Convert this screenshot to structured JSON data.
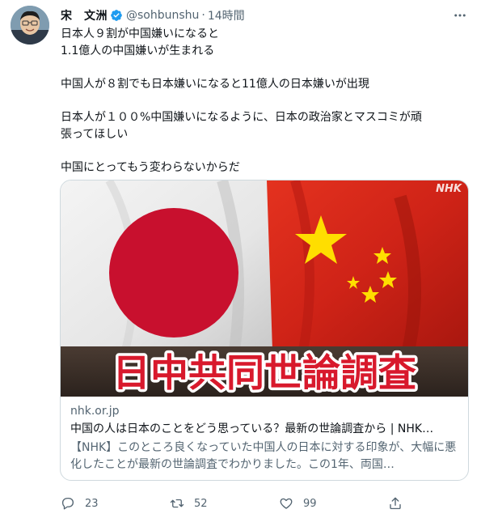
{
  "author": {
    "name": "宋　文洲",
    "handle": "@sohbunshu",
    "separator": "·",
    "time": "14時間"
  },
  "tweet": {
    "lines": [
      "日本人９割が中国嫌いになると",
      "1.1億人の中国嫌いが生まれる",
      "中国人が８割でも日本嫌いになると11億人の日本嫌いが出現",
      "日本人が１００%中国嫌いになるように、日本の政治家とマスコミが頑",
      "張ってほしい",
      "中国にとってもう変わらないからだ"
    ]
  },
  "card": {
    "image_banner": "日中共同世論調査",
    "image_watermark": "NHK",
    "domain": "nhk.or.jp",
    "title": "中国の人は日本のことをどう思っている？最新の世論調査から | NHK…",
    "description": "【NHK】このところ良くなっていた中国人の日本に対する印象が、大幅に悪化したことが最新の世論調査でわかりました。この1年、両国…"
  },
  "actions": {
    "reply_count": "23",
    "retweet_count": "52",
    "like_count": "99"
  },
  "icons": {
    "verified": "verified-badge-icon",
    "more": "more-icon",
    "reply": "reply-icon",
    "retweet": "retweet-icon",
    "like": "heart-icon",
    "share": "share-icon"
  },
  "colors": {
    "verified": "#1d9bf0",
    "secondary_text": "#536471",
    "flag_red": "#bc002d",
    "china_red": "#de2910",
    "china_star": "#ffde00",
    "banner_text": "#d8192c"
  }
}
